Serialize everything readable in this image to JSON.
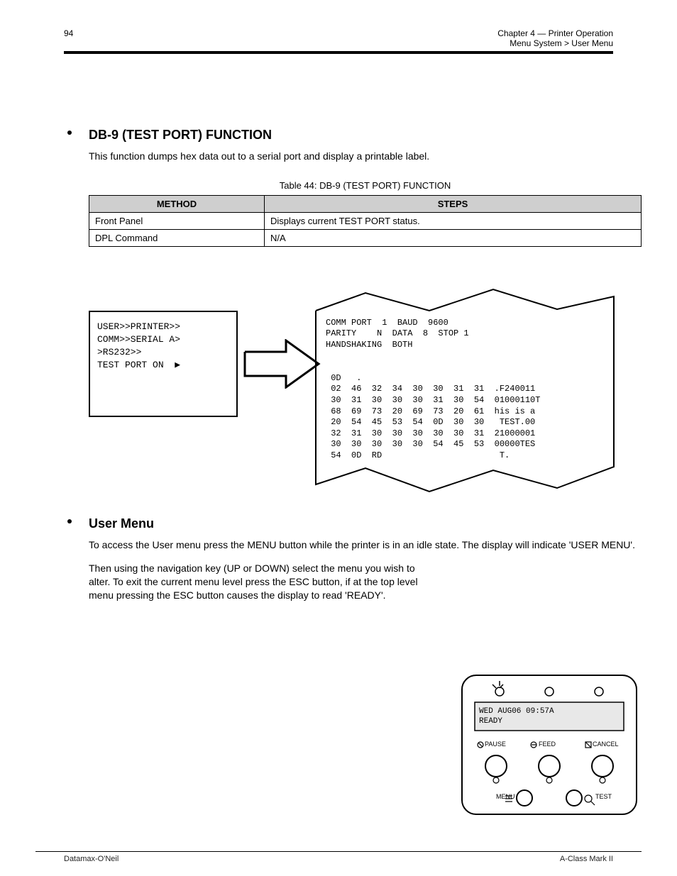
{
  "header": {
    "chapter_number": "94",
    "chapter_title": "Chapter 4 — Printer Operation",
    "section_path": "Menu System > User Menu"
  },
  "section1": {
    "title": "DB-9 (TEST PORT) FUNCTION",
    "intro": "This function dumps hex data out to a serial port and display a printable label.",
    "table_caption": "Table 44:  DB-9 (TEST PORT) FUNCTION",
    "headers": [
      "METHOD",
      "STEPS"
    ],
    "rows": [
      {
        "method": "Front Panel",
        "steps": "Displays current TEST PORT status."
      },
      {
        "method": "DPL Command",
        "steps": "N/A"
      }
    ],
    "lcd": "USER>>PRINTER>>\nCOMM>>SERIAL A>\n>RS232>>\nTEST PORT ON  ▶",
    "label_lines": "COMM PORT  1  BAUD  9600\nPARITY    N  DATA  8  STOP 1\nHANDSHAKING  BOTH\n\n\n 0D   .\n 02  46  32  34  30  30  31  31  .F240011\n 30  31  30  30  30  31  30  54  01000110T\n 68  69  73  20  69  73  20  61  his is a\n 20  54  45  53  54  0D  30  30   TEST.00\n 32  31  30  30  30  30  30  31  21000001\n 30  30  30  30  30  54  45  53  00000TES\n 54  0D  RD                       T."
  },
  "section2": {
    "title": "User Menu",
    "body1": "To access the User menu press the MENU button while the printer is in an idle state. The display will indicate 'USER MENU'.",
    "body2": "Then using the navigation key (UP or DOWN) select the menu you wish to alter. To exit the current menu level press the ESC button, if at the top level menu pressing the ESC button causes the display to read 'READY'."
  },
  "panel": {
    "lcd_line1": "WED AUG06 09:57A",
    "lcd_line2": "READY",
    "buttons": {
      "pause": "PAUSE",
      "feed": "FEED",
      "cancel": "CANCEL",
      "menu": "MENU",
      "test": "TEST"
    }
  },
  "footer": {
    "left": "Datamax-O'Neil",
    "right": "A-Class Mark II"
  }
}
